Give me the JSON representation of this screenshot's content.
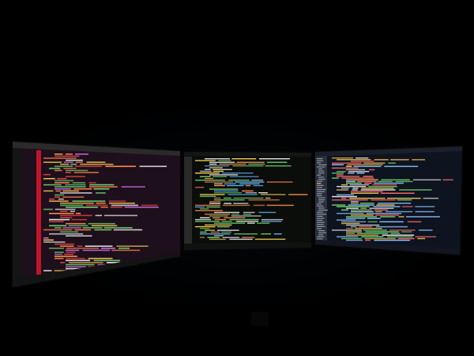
{
  "scene": {
    "background_color": "#000000",
    "monitors": [
      {
        "id": "left",
        "theme": "dark-editor",
        "palette": {
          "bg": "#1e0f1c",
          "titlebar": "#2a2a2a",
          "gutter": "#c0142a",
          "code": [
            "#e84545",
            "#f2c14e",
            "#6fd36f",
            "#e8e8e8",
            "#c86bd8",
            "#ff8a4c"
          ]
        }
      },
      {
        "id": "center",
        "theme": "terminal-editor",
        "palette": {
          "bg": "#0b0d0b",
          "titlebar": "#151515",
          "gutter": "#2a2a2a",
          "code": [
            "#6fd36f",
            "#f2d04e",
            "#ff8a4c",
            "#e8e8e8",
            "#5fb7ff"
          ]
        }
      },
      {
        "id": "right",
        "theme": "ide-with-tree",
        "palette": {
          "bg": "#0e1320",
          "titlebar": "#1a1f2a",
          "gutter": "#2b2f3a",
          "code": [
            "#8fc8ff",
            "#e8e8e8",
            "#f2c14e",
            "#6fd36f",
            "#ff6b6b"
          ]
        }
      }
    ]
  }
}
